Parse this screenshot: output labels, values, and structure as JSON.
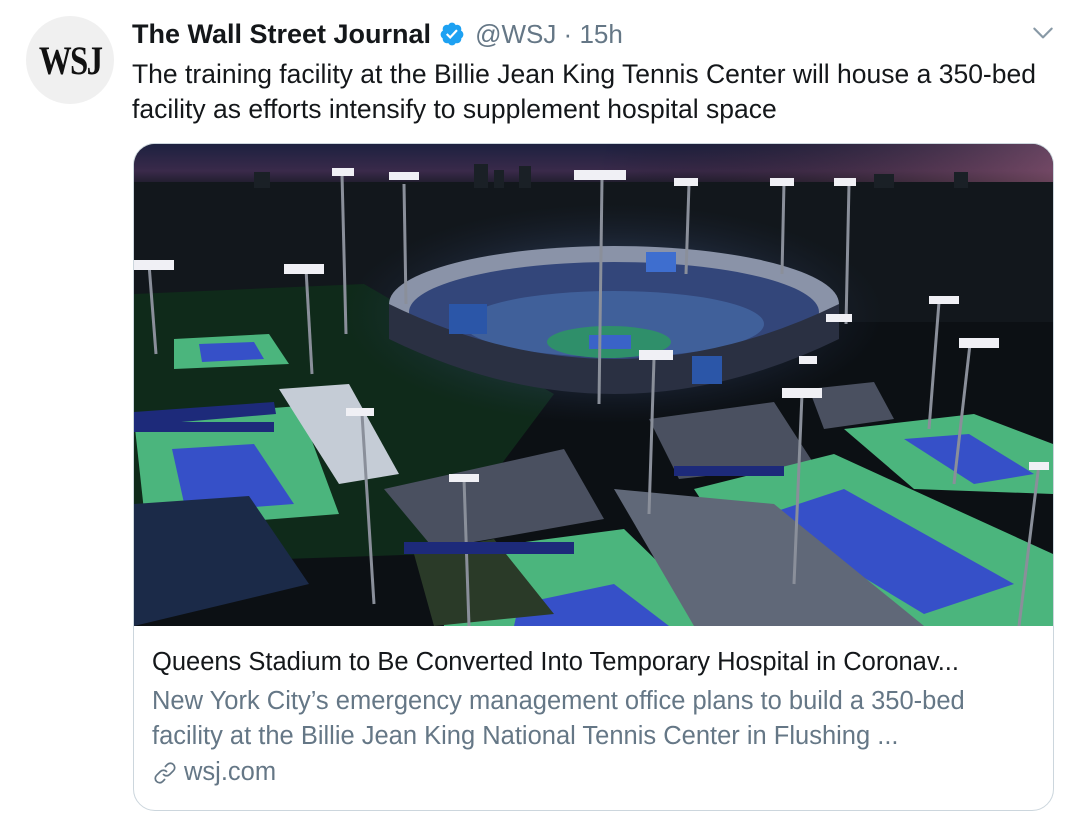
{
  "tweet": {
    "avatar_text": "WSJ",
    "author_name": "The Wall Street Journal",
    "handle_time": "@WSJ · 15h",
    "text": "The training facility at the Billie Jean King Tennis Center will house a 350-bed facility as efforts intensify to supplement hospital space",
    "verified_color": "#1da1f2"
  },
  "card": {
    "image_alt": "Aerial night view of the tennis center stadium and courts",
    "title": "Queens Stadium to Be Converted Into Temporary Hospital in Coronav...",
    "description": "New York City’s emergency management office plans to build a 350-bed facility at the Billie Jean King National Tennis Center in Flushing ...",
    "domain": "wsj.com",
    "link_icon": "link-icon"
  }
}
